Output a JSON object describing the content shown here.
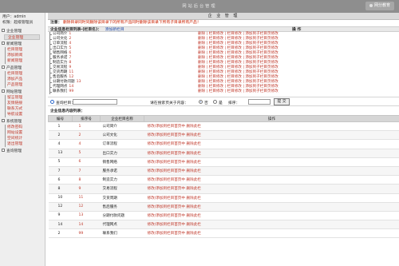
{
  "header": {
    "title": "网站后台管理",
    "logo_text": "网分教育"
  },
  "sidebar": {
    "user_line1": "用户：admin",
    "user_line2": "权限：超级管理员",
    "groups": [
      {
        "title": "企业管理",
        "items": [
          "企业管理"
        ]
      },
      {
        "title": "新闻管理",
        "items": [
          "栏目管理",
          "添加新闻",
          "新闻管理"
        ]
      },
      {
        "title": "产品管理",
        "items": [
          "栏目管理",
          "添加产品",
          "产品管理"
        ]
      },
      {
        "title": "网站管理",
        "items": [
          "留言管理",
          "友情链接",
          "联系方式",
          "导航设置"
        ]
      },
      {
        "title": "系统管理",
        "items": [
          "修改密码",
          "网站设置",
          "空间统计",
          "退出管理"
        ]
      },
      {
        "title": "查询管理",
        "items": []
      }
    ]
  },
  "main": {
    "title": "企 业 管 理",
    "tip_label": "注意：",
    "tip_text": "删除目录同时同删除该目录下的所有产品同时删除该目录下所有子目录所有产品！",
    "section1_title": "企业信息栏目列表-(栏目名)：",
    "section1_add": "添加新栏目",
    "ops_header": "操 作",
    "tree_ops": "删除 | 栏目修改 | 栏目修改 | 添加到子栏目页修改",
    "tree": [
      {
        "name": "公司简介",
        "num": "1"
      },
      {
        "name": "公司文化",
        "num": "2"
      },
      {
        "name": "订单流程",
        "num": "4"
      },
      {
        "name": "出口实力",
        "num": "5"
      },
      {
        "name": "销售网络",
        "num": "6"
      },
      {
        "name": "服务承诺",
        "num": "7"
      },
      {
        "name": "制造实力",
        "num": "8"
      },
      {
        "name": "交易流程",
        "num": "9"
      },
      {
        "name": "交货周期",
        "num": "11"
      },
      {
        "name": "售后服务",
        "num": "12"
      },
      {
        "name": "分期付款问题",
        "num": "13"
      },
      {
        "name": "代理网点",
        "num": "14"
      },
      {
        "name": "联系我们",
        "num": "99"
      }
    ],
    "search": {
      "label1": "查询栏目：",
      "label2": "请在搜索页关于内容：",
      "radio1": "否",
      "radio2": "是",
      "label3": "排序：",
      "button": "提 交"
    },
    "list_title": "企业信息内容列表：",
    "table": {
      "headers": [
        "编号",
        "排序号",
        "企业栏目名称",
        "操作"
      ],
      "op_text": "修改/添加到栏目首页中",
      "op_delete": "删除此栏",
      "rows": [
        {
          "id": "1",
          "sort": "1",
          "name": "公司简介"
        },
        {
          "id": "2",
          "sort": "2",
          "name": "公司文化"
        },
        {
          "id": "4",
          "sort": "4",
          "name": "订单流程"
        },
        {
          "id": "13",
          "sort": "5",
          "name": "出口实力"
        },
        {
          "id": "5",
          "sort": "6",
          "name": "销售网络"
        },
        {
          "id": "7",
          "sort": "7",
          "name": "服务承诺"
        },
        {
          "id": "6",
          "sort": "8",
          "name": "制造实力"
        },
        {
          "id": "8",
          "sort": "9",
          "name": "交易流程"
        },
        {
          "id": "10",
          "sort": "11",
          "name": "交货周期"
        },
        {
          "id": "12",
          "sort": "12",
          "name": "售后服务"
        },
        {
          "id": "9",
          "sort": "13",
          "name": "分期付款问题"
        },
        {
          "id": "14",
          "sort": "14",
          "name": "代理网点"
        },
        {
          "id": "2",
          "sort": "99",
          "name": "联系我们"
        }
      ]
    }
  },
  "colors": {
    "header_bg": "#8e8e8e",
    "link_red": "#c0392b",
    "link_blue": "#1f4aa8"
  }
}
